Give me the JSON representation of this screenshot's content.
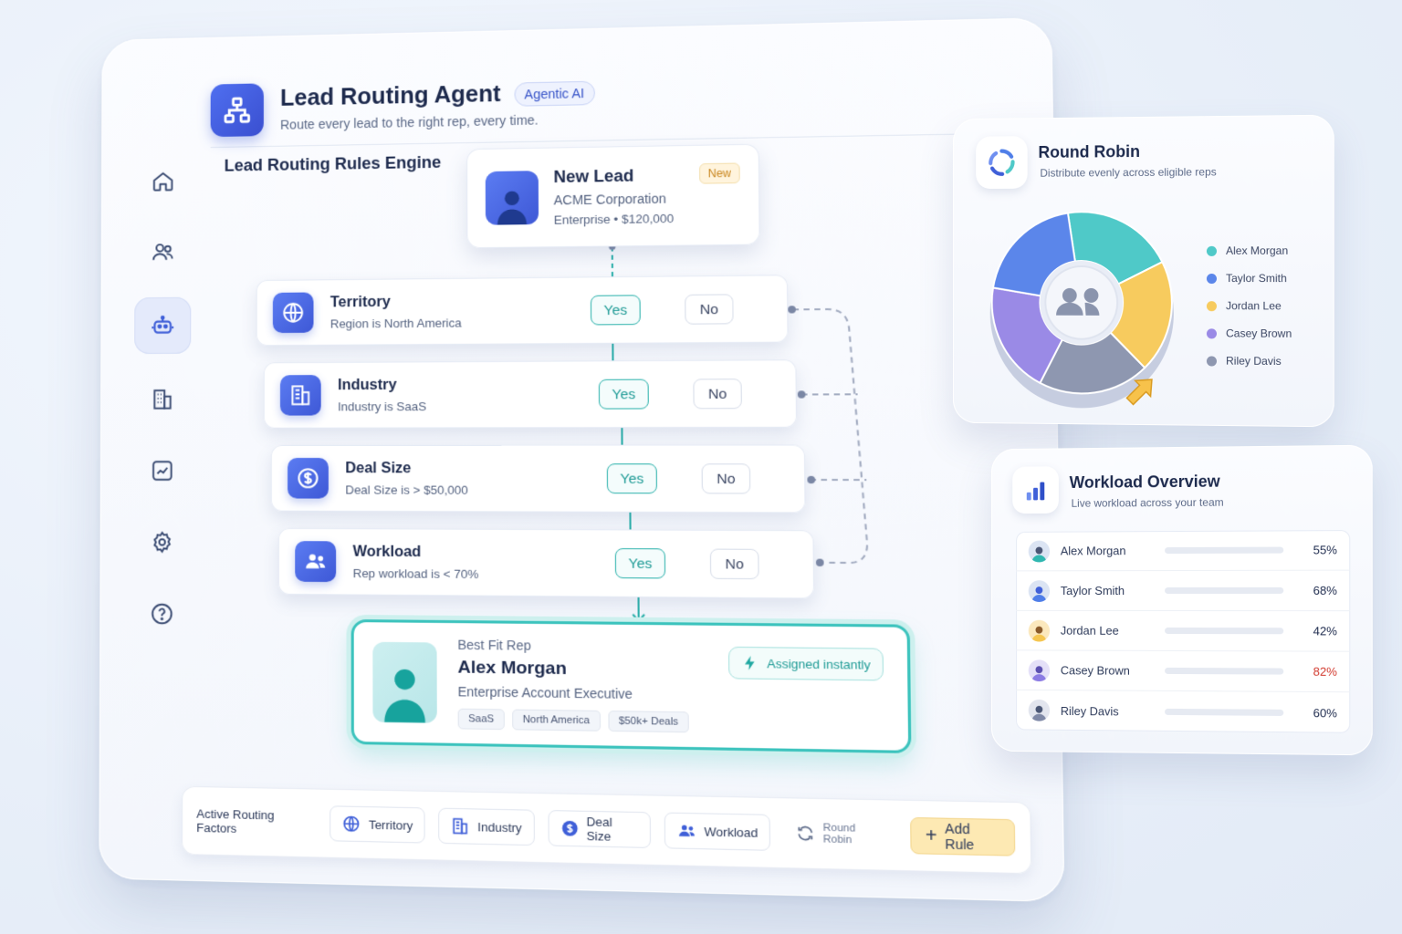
{
  "app": {
    "title": "Lead Routing Agent",
    "badge": "Agentic AI",
    "subtitle": "Route every lead to the right rep, every time."
  },
  "sidebar": {
    "items": [
      {
        "icon": "home-icon"
      },
      {
        "icon": "users-icon"
      },
      {
        "icon": "robot-icon",
        "active": true
      },
      {
        "icon": "building-icon"
      },
      {
        "icon": "chart-icon"
      },
      {
        "icon": "gear-icon"
      },
      {
        "icon": "help-icon"
      }
    ]
  },
  "engine": {
    "title": "Lead Routing Rules Engine",
    "new_lead": {
      "name": "New Lead",
      "badge": "New",
      "company": "ACME Corporation",
      "deal": "Enterprise • $120,000"
    },
    "rules": [
      {
        "name": "Territory",
        "condition": "Region is North America",
        "yes": "Yes",
        "no": "No",
        "icon": "globe-icon"
      },
      {
        "name": "Industry",
        "condition": "Industry is SaaS",
        "yes": "Yes",
        "no": "No",
        "icon": "building-icon"
      },
      {
        "name": "Deal Size",
        "condition": "Deal Size is > $50,000",
        "yes": "Yes",
        "no": "No",
        "icon": "dollar-icon"
      },
      {
        "name": "Workload",
        "condition": "Rep workload is < 70%",
        "yes": "Yes",
        "no": "No",
        "icon": "users-icon"
      }
    ],
    "best_fit": {
      "label": "Best Fit Rep",
      "name": "Alex Morgan",
      "role": "Enterprise Account Executive",
      "tags": [
        "SaaS",
        "North America",
        "$50k+ Deals"
      ],
      "assigned": "Assigned instantly"
    }
  },
  "factors": {
    "label": "Active Routing Factors",
    "chips": [
      "Territory",
      "Industry",
      "Deal Size",
      "Workload",
      "Round Robin"
    ],
    "add_rule": "Add Rule"
  },
  "round_robin": {
    "title": "Round Robin",
    "subtitle": "Distribute evenly across eligible reps",
    "legend": [
      {
        "name": "Alex Morgan",
        "color": "#4fc9c8"
      },
      {
        "name": "Taylor Smith",
        "color": "#5b86ea"
      },
      {
        "name": "Jordan Lee",
        "color": "#f7cb5e"
      },
      {
        "name": "Casey Brown",
        "color": "#9a8ae6"
      },
      {
        "name": "Riley Davis",
        "color": "#8e97b0"
      }
    ]
  },
  "workload": {
    "title": "Workload Overview",
    "subtitle": "Live workload across your team",
    "rows": [
      {
        "name": "Alex Morgan",
        "pct": "55%",
        "value": 55,
        "color": "#2fb7b0",
        "pct_color": "#1d2a4d"
      },
      {
        "name": "Taylor Smith",
        "pct": "68%",
        "value": 68,
        "color": "#4f7ee8",
        "pct_color": "#1d2a4d"
      },
      {
        "name": "Jordan Lee",
        "pct": "42%",
        "value": 42,
        "color": "#f5c650",
        "pct_color": "#1d2a4d"
      },
      {
        "name": "Casey Brown",
        "pct": "82%",
        "value": 82,
        "color": "#8b7be3",
        "pct_color": "#d23a2f"
      },
      {
        "name": "Riley Davis",
        "pct": "60%",
        "value": 60,
        "color": "#7e88a6",
        "pct_color": "#1d2a4d"
      }
    ]
  }
}
